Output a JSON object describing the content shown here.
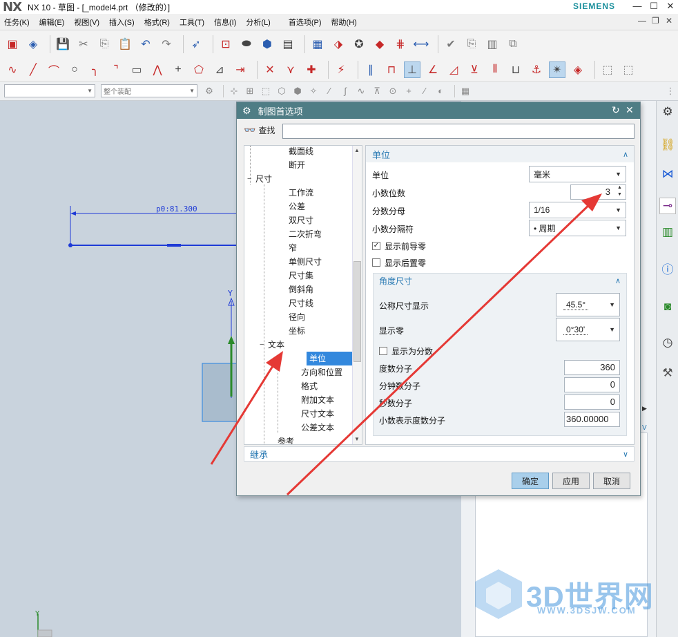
{
  "window": {
    "logo": "NX",
    "title": "NX 10 - 草图 - [_model4.prt （修改的）]",
    "brand": "SIEMENS"
  },
  "menubar": {
    "items": [
      "任务(K)",
      "编辑(E)",
      "视图(V)",
      "插入(S)",
      "格式(R)",
      "工具(T)",
      "信息(I)",
      "分析(L)",
      "首选项(P)",
      "帮助(H)"
    ]
  },
  "selection_bar": {
    "filter_value": "",
    "assembly_value": "整个装配"
  },
  "canvas": {
    "dimension_text": "p0:81.300",
    "axis_y": "Y"
  },
  "dialog": {
    "title": "制图首选项",
    "find_label": "查找",
    "find_value": "",
    "tree": [
      {
        "label": "截面线",
        "indent": 2
      },
      {
        "label": "断开",
        "indent": 2
      },
      {
        "label": "尺寸",
        "indent": 0,
        "expander": "−"
      },
      {
        "label": "工作流",
        "indent": 2
      },
      {
        "label": "公差",
        "indent": 2
      },
      {
        "label": "双尺寸",
        "indent": 2
      },
      {
        "label": "二次折弯",
        "indent": 2
      },
      {
        "label": "窄",
        "indent": 2
      },
      {
        "label": "单侧尺寸",
        "indent": 2
      },
      {
        "label": "尺寸集",
        "indent": 2
      },
      {
        "label": "倒斜角",
        "indent": 2
      },
      {
        "label": "尺寸线",
        "indent": 2
      },
      {
        "label": "径向",
        "indent": 2
      },
      {
        "label": "坐标",
        "indent": 2
      },
      {
        "label": "文本",
        "indent": 1,
        "expander": "−"
      },
      {
        "label": "单位",
        "indent": 3,
        "selected": true
      },
      {
        "label": "方向和位置",
        "indent": 3
      },
      {
        "label": "格式",
        "indent": 3
      },
      {
        "label": "附加文本",
        "indent": 3
      },
      {
        "label": "尺寸文本",
        "indent": 3
      },
      {
        "label": "公差文本",
        "indent": 3
      },
      {
        "label": "参考",
        "indent": 1
      }
    ],
    "units_section": {
      "title": "单位",
      "unit_label": "单位",
      "unit_value": "毫米",
      "decimals_label": "小数位数",
      "decimals_value": "3",
      "denominator_label": "分数分母",
      "denominator_value": "1/16",
      "separator_label": "小数分隔符",
      "separator_value": "• 周期",
      "leading_zero_label": "显示前导零",
      "leading_zero_checked": true,
      "trailing_zero_label": "显示后置零",
      "trailing_zero_checked": false
    },
    "angle_section": {
      "title": "角度尺寸",
      "nominal_label": "公称尺寸显示",
      "nominal_value": "45.5°",
      "zero_label": "显示零",
      "zero_value": "0°30'",
      "as_fraction_label": "显示为分数",
      "as_fraction_checked": false,
      "deg_numerator_label": "度数分子",
      "deg_numerator_value": "360",
      "min_numerator_label": "分钟数分子",
      "min_numerator_value": "0",
      "sec_numerator_label": "秒数分子",
      "sec_numerator_value": "0",
      "decimal_deg_label": "小数表示度数分子",
      "decimal_deg_value": "360.00000"
    },
    "inherit_label": "继承",
    "buttons": {
      "ok": "确定",
      "apply": "应用",
      "cancel": "取消"
    }
  },
  "watermark": {
    "text": "3D世界网",
    "url": "WWW.3DSJW.COM"
  },
  "colors": {
    "dialog_title_bg": "#4f7d85",
    "section_text": "#2b7bb4",
    "selection": "#3388dd",
    "annotation_arrow": "#e53935",
    "sketch_line": "#1e3ad6"
  }
}
